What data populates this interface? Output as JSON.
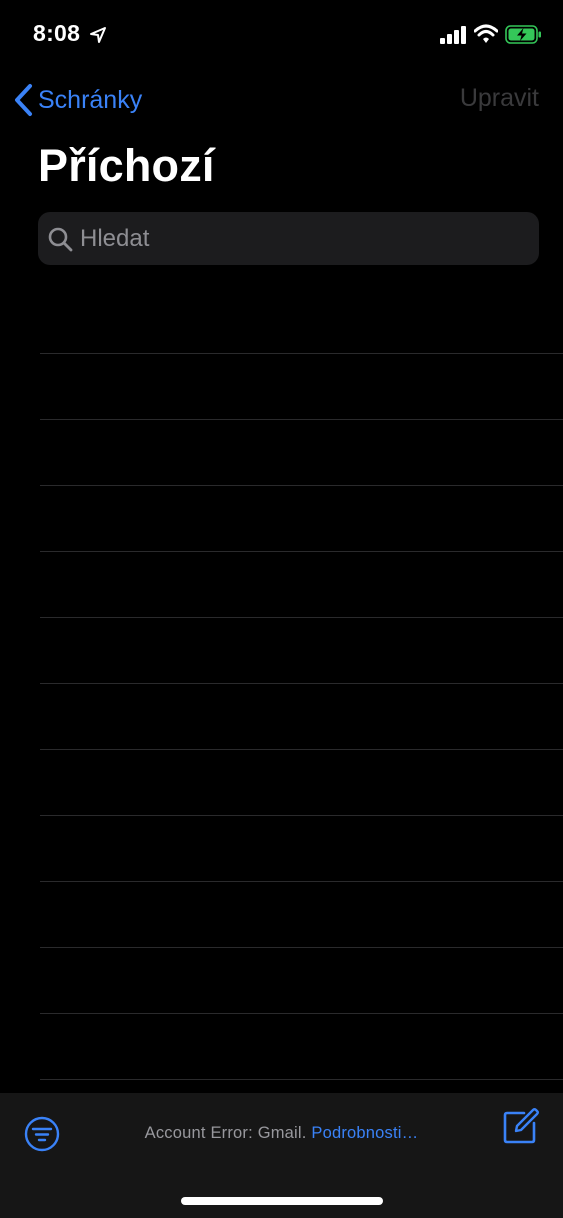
{
  "status_bar": {
    "time": "8:08",
    "icons": [
      "location-arrow-icon",
      "cellular-signal-icon",
      "wifi-icon",
      "battery-charging-icon"
    ]
  },
  "nav": {
    "back_label": "Schránky",
    "edit_label": "Upravit",
    "title": "Příchozí"
  },
  "search": {
    "placeholder": "Hledat"
  },
  "toolbar": {
    "status_text": "Account Error: Gmail.",
    "details_link": "Podrobnosti…"
  },
  "colors": {
    "accent": "#3a82f7",
    "background": "#000000",
    "search_bg": "#1c1c1e",
    "disabled": "#3a3a3c",
    "battery_green": "#34c759"
  }
}
